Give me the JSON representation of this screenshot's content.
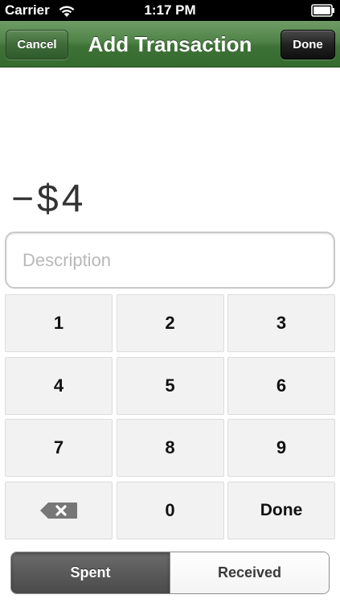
{
  "status_bar": {
    "carrier": "Carrier",
    "time": "1:17 PM",
    "wifi_icon": "wifi-icon",
    "battery_icon": "battery-icon"
  },
  "nav_bar": {
    "title": "Add Transaction",
    "cancel_label": "Cancel",
    "done_label": "Done",
    "color": "#4f8347"
  },
  "amount": {
    "display": "−$4"
  },
  "description": {
    "value": "",
    "placeholder": "Description"
  },
  "keypad": {
    "keys": [
      "1",
      "2",
      "3",
      "4",
      "5",
      "6",
      "7",
      "8",
      "9",
      "",
      "0",
      "Done"
    ],
    "backspace_icon": "backspace-icon"
  },
  "type_selector": {
    "options": [
      "Spent",
      "Received"
    ],
    "selected": "Spent"
  }
}
